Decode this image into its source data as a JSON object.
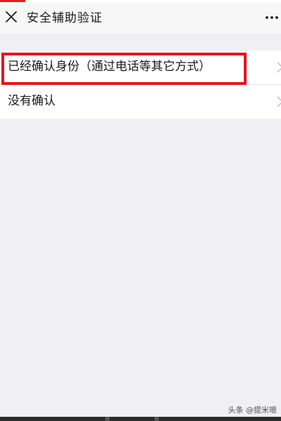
{
  "nav": {
    "title": "安全辅助验证",
    "close_icon": "close-icon",
    "more_icon": "more-icon"
  },
  "list": {
    "items": [
      {
        "label": "已经确认身份（通过电话等其它方式）",
        "icon": "chevron-right-icon"
      },
      {
        "label": "没有确认",
        "icon": "chevron-right-icon"
      }
    ]
  },
  "annotation": {
    "highlight_color": "#e8141d"
  },
  "watermark": {
    "text": "头条 @提米嗯"
  },
  "colors": {
    "background": "#efeff4",
    "nav_background": "#f7f7f7",
    "text": "#1a1a1a",
    "chevron": "#c7c7cc"
  }
}
